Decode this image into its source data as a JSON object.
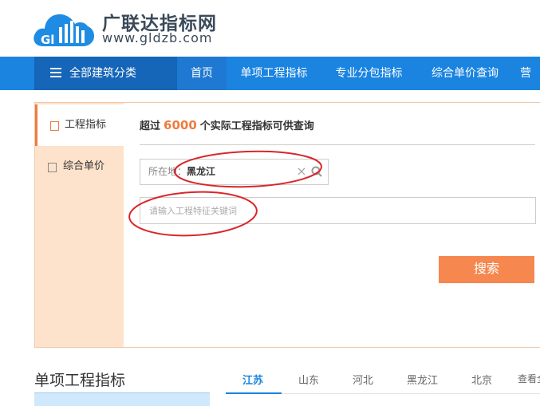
{
  "brand": {
    "title": "广联达指标网",
    "url": "www.gldzb.com",
    "logo_letters": "Gl"
  },
  "nav": {
    "category_label": "全部建筑分类",
    "items": [
      {
        "label": "首页",
        "active": true
      },
      {
        "label": "单项工程指标",
        "active": false
      },
      {
        "label": "专业分包指标",
        "active": false
      },
      {
        "label": "综合单价查询",
        "active": false
      },
      {
        "label": "营",
        "active": false
      }
    ]
  },
  "sidebar": {
    "items": [
      {
        "label": "工程指标",
        "active": true
      },
      {
        "label": "综合单价",
        "active": false
      }
    ]
  },
  "search": {
    "headline_prefix": "超过",
    "headline_count": "6000",
    "headline_suffix": "个实际工程指标可供查询",
    "location_label": "所在地：",
    "location_value": "黑龙江",
    "clear_glyph": "×",
    "keyword_placeholder": "请输入工程特征关键词",
    "keyword_value": "",
    "button_label": "搜索"
  },
  "section": {
    "title": "单项工程指标",
    "region_tabs": [
      {
        "label": "江苏",
        "active": true
      },
      {
        "label": "山东",
        "active": false
      },
      {
        "label": "河北",
        "active": false
      },
      {
        "label": "黑龙江",
        "active": false
      },
      {
        "label": "北京",
        "active": false
      },
      {
        "label": "查看全",
        "active": false
      }
    ]
  },
  "colors": {
    "nav_blue": "#1a84e0",
    "accent_orange": "#f07b3f",
    "sidebar_peach": "#fde2cc",
    "annotation_red": "#d9262a"
  },
  "icons": [
    "menu-icon",
    "building-icon",
    "document-icon",
    "search-icon",
    "close-icon"
  ]
}
